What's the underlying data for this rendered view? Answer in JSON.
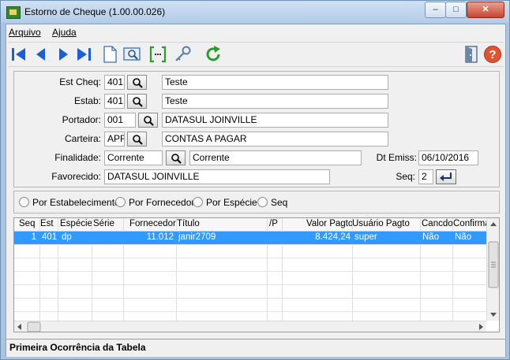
{
  "window": {
    "title": "Estorno de Cheque (1.00.00.026)",
    "minimize": "–",
    "maximize": "□",
    "close": "✕"
  },
  "menu": {
    "items": [
      {
        "label": "Arquivo"
      },
      {
        "label": "Ajuda"
      }
    ]
  },
  "toolbar": {
    "buttons": [
      {
        "name": "first-record-icon"
      },
      {
        "name": "previous-record-icon"
      },
      {
        "name": "next-record-icon"
      },
      {
        "name": "last-record-icon"
      },
      {
        "name": "new-document-icon"
      },
      {
        "name": "zoom-view-icon"
      },
      {
        "name": "bracket-goto-icon"
      },
      {
        "name": "key-search-icon"
      },
      {
        "name": "refresh-icon"
      },
      {
        "name": "exit-door-icon"
      },
      {
        "name": "help-icon"
      }
    ]
  },
  "form": {
    "est_cheq": {
      "label": "Est Cheq:",
      "code": "401",
      "desc": "Teste"
    },
    "estab": {
      "label": "Estab:",
      "code": "401",
      "desc": "Teste"
    },
    "portador": {
      "label": "Portador:",
      "code": "001",
      "desc": "DATASUL JOINVILLE"
    },
    "carteira": {
      "label": "Carteira:",
      "code": "APR",
      "desc": "CONTAS A PAGAR"
    },
    "finalidade": {
      "label": "Finalidade:",
      "code": "Corrente",
      "desc": "Corrente"
    },
    "dt_emiss": {
      "label": "Dt Emiss:",
      "value": "06/10/2016"
    },
    "favorecido": {
      "label": "Favorecido:",
      "value": "DATASUL JOINVILLE"
    },
    "seq": {
      "label": "Seq:",
      "value": "2"
    }
  },
  "sort_options": [
    {
      "label": "Por Estabelecimento"
    },
    {
      "label": "Por Fornecedor"
    },
    {
      "label": "Por Espécie"
    },
    {
      "label": "Seq"
    }
  ],
  "grid": {
    "columns": [
      "Seq",
      "Est",
      "Espécie",
      "Série",
      "Fornecedor",
      "Título",
      "/P",
      "Valor Pagto",
      "Usuário Pagto",
      "Cancdo",
      "Confirma"
    ],
    "rows": [
      {
        "seq": "1",
        "est": "401",
        "especie": "dp",
        "serie": "",
        "fornecedor": "11.012",
        "titulo": "janir2709",
        "p": "",
        "valor": "8.424,24",
        "usuario": "super",
        "cancdo": "Não",
        "confirma": "Não"
      }
    ]
  },
  "status": {
    "text": "Primeira Ocorrência da Tabela"
  },
  "colors": {
    "selection": "#3399ff",
    "titlebar": "#b9d1ea",
    "close": "#c74532"
  }
}
